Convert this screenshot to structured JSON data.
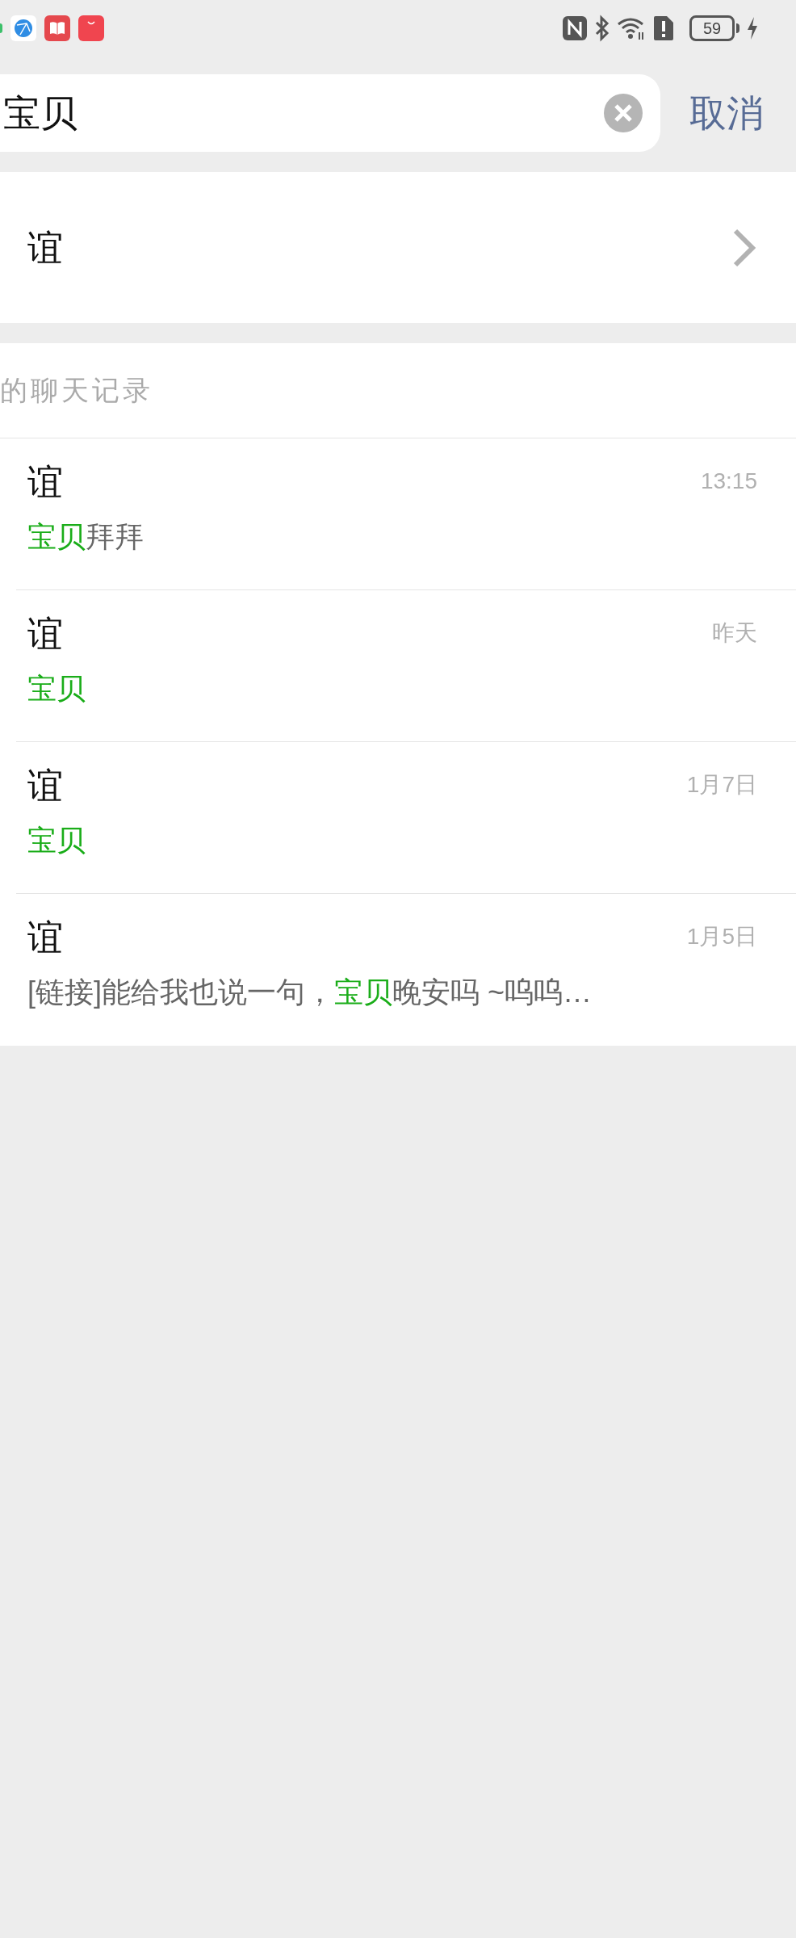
{
  "status_bar": {
    "battery": "59"
  },
  "search": {
    "value": "宝贝",
    "cancel": "取消"
  },
  "contact": {
    "name": "谊"
  },
  "chat_records": {
    "header": "的聊天记录",
    "rows": [
      {
        "name": "谊",
        "time": "13:15",
        "preview": [
          {
            "text": "宝贝",
            "highlight": true
          },
          {
            "text": "拜拜",
            "highlight": false
          }
        ]
      },
      {
        "name": "谊",
        "time": "昨天",
        "preview": [
          {
            "text": "宝贝",
            "highlight": true
          }
        ]
      },
      {
        "name": "谊",
        "time": "1月7日",
        "preview": [
          {
            "text": "宝贝",
            "highlight": true
          }
        ]
      },
      {
        "name": "谊",
        "time": "1月5日",
        "preview": [
          {
            "text": "[链接]能给我也说一句，",
            "highlight": false
          },
          {
            "text": "宝贝",
            "highlight": true
          },
          {
            "text": "晚安吗 ~呜呜…",
            "highlight": false
          }
        ]
      }
    ]
  }
}
